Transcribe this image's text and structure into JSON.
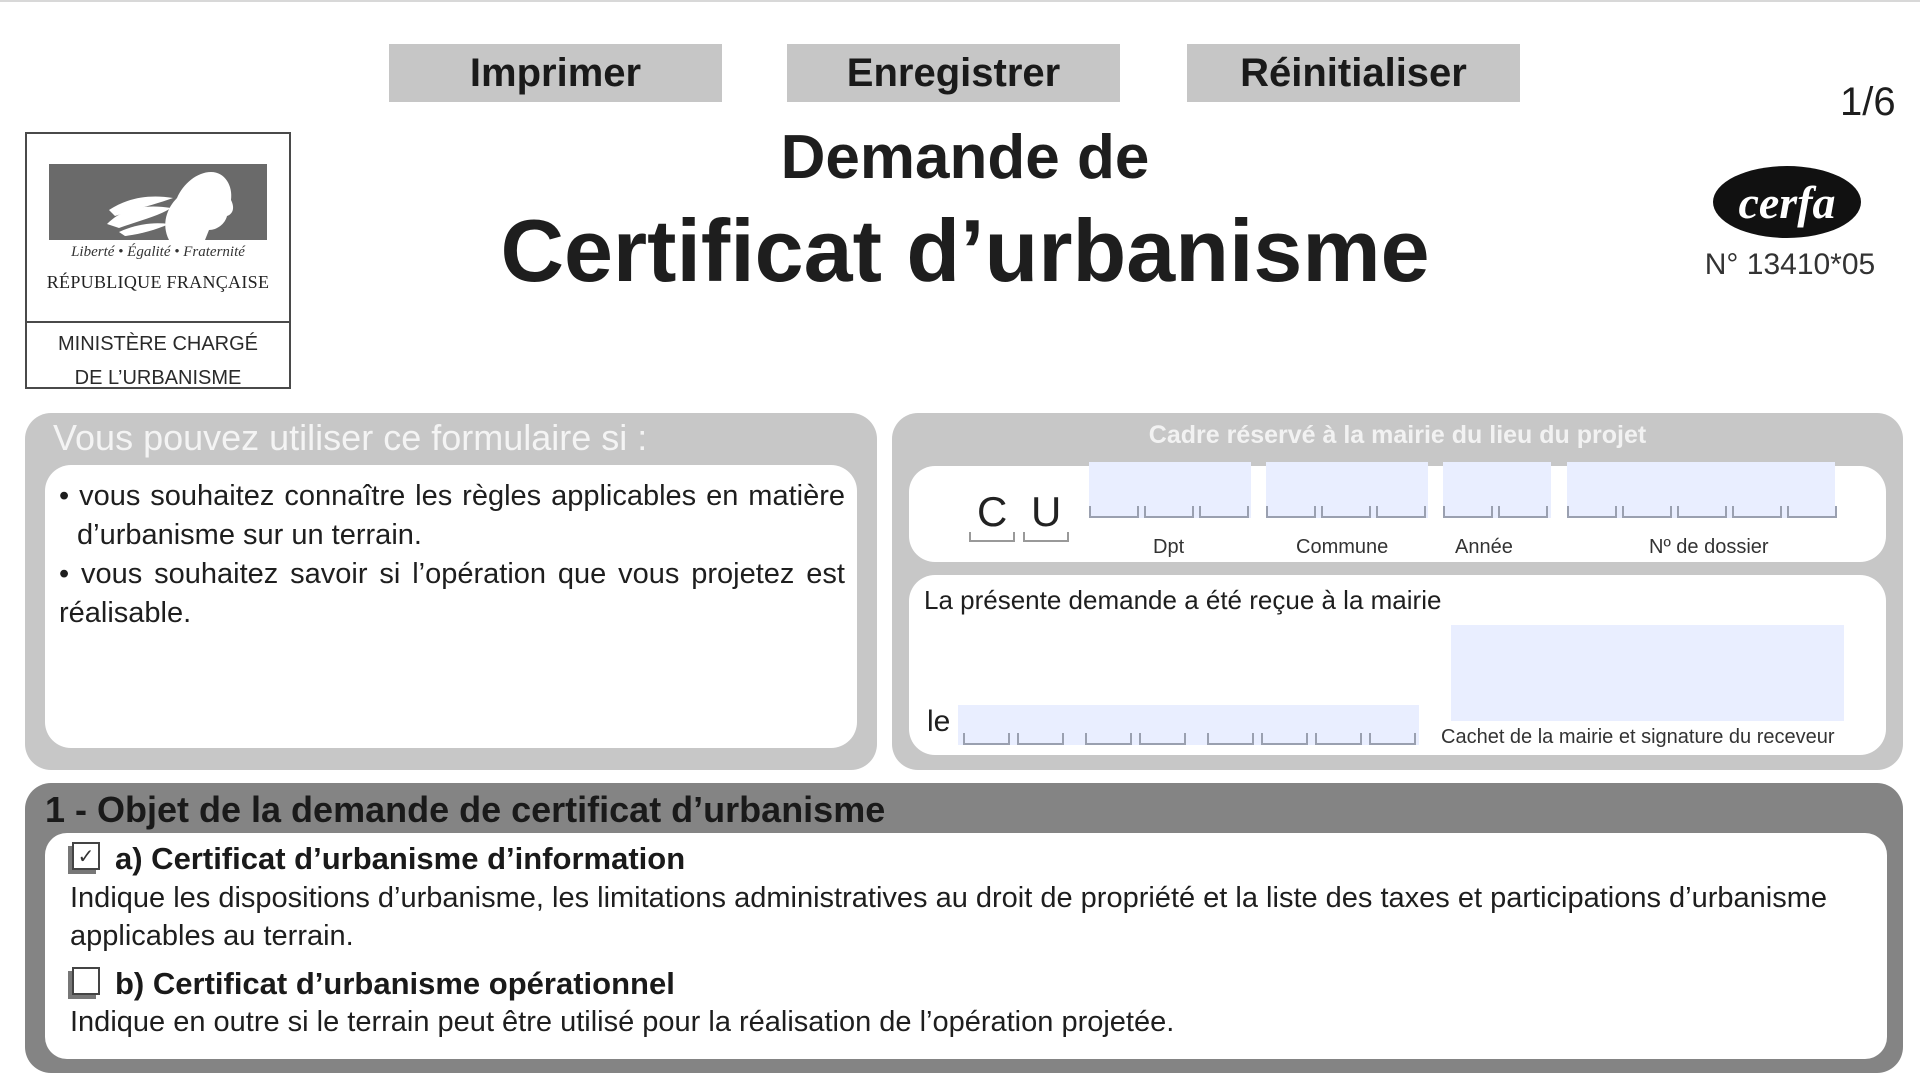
{
  "toolbar": {
    "print_label": "Imprimer",
    "save_label": "Enregistrer",
    "reset_label": "Réinitialiser"
  },
  "page_number": "1/6",
  "ministry": {
    "motto": "Liberté • Égalité • Fraternité",
    "republic": "RÉPUBLIQUE FRANÇAISE",
    "line1": "MINISTÈRE CHARGÉ",
    "line2": "DE L’URBANISME"
  },
  "title": {
    "line1": "Demande de",
    "line2": "Certificat d’urbanisme"
  },
  "cerfa": {
    "logo_text": "cerfa",
    "number": "N° 13410*05"
  },
  "usage_panel": {
    "heading": "Vous pouvez utiliser ce formulaire si :",
    "bullets": [
      "• vous souhaitez connaître les règles applicables en matière d’urbanisme sur un terrain.",
      "• vous souhaitez savoir si l’opération que vous projetez est réalisable."
    ]
  },
  "mairie_panel": {
    "heading": "Cadre réservé à la mairie du lieu du projet",
    "cu_letters": [
      "C",
      "U"
    ],
    "field_labels": {
      "dpt": "Dpt",
      "commune": "Commune",
      "annee": "Année",
      "dossier": "Nº de dossier"
    },
    "received_text": "La présente demande a été reçue à la mairie",
    "le_label": "le",
    "stamp_caption": "Cachet de la mairie et signature du receveur"
  },
  "section1": {
    "heading": "1 - Objet de la demande de certificat d’urbanisme",
    "options": [
      {
        "title": "a) Certificat d’urbanisme d’information",
        "description": "Indique les dispositions d’urbanisme, les limitations administratives au droit de propriété et la liste des taxes et participations d’urbanisme applicables au terrain.",
        "checked": true,
        "check_glyph": "✓"
      },
      {
        "title": "b) Certificat d’urbanisme opérationnel",
        "description": "Indique en outre si le terrain peut être utilisé pour la réalisation de l’opération projetée.",
        "checked": false,
        "check_glyph": ""
      }
    ]
  },
  "colors": {
    "panel_grey": "#c7c7c7",
    "section_grey": "#848484",
    "field_fill": "#e9eeff",
    "button_grey": "#c6c6c6"
  }
}
